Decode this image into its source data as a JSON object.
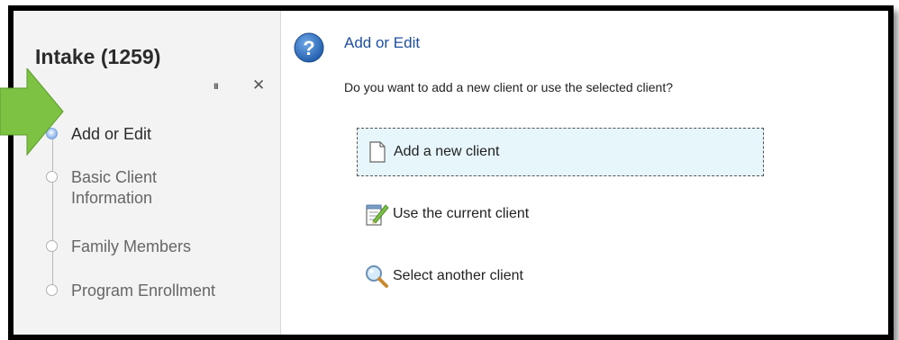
{
  "sidebar": {
    "title": "Intake (1259)",
    "pin_label": "ıı",
    "close_label": "✕",
    "steps": [
      {
        "label": "Add or Edit",
        "active": true
      },
      {
        "label": "Basic Client Information",
        "active": false
      },
      {
        "label": "Family Members",
        "active": false
      },
      {
        "label": "Program Enrollment",
        "active": false
      }
    ]
  },
  "main": {
    "title": "Add or Edit",
    "prompt": "Do you want to add a new client or use the selected client?",
    "options": [
      {
        "label": "Add a new client",
        "icon": "new-document-icon",
        "selected": true
      },
      {
        "label": "Use the current client",
        "icon": "edit-notepad-icon",
        "selected": false
      },
      {
        "label": "Select another client",
        "icon": "magnifier-icon",
        "selected": false
      }
    ]
  },
  "colors": {
    "accent_arrow": "#7dc242",
    "title_blue": "#1f4fa1",
    "help_icon_blue": "#2a6fc4",
    "selected_option_bg": "#e6f6fb"
  }
}
